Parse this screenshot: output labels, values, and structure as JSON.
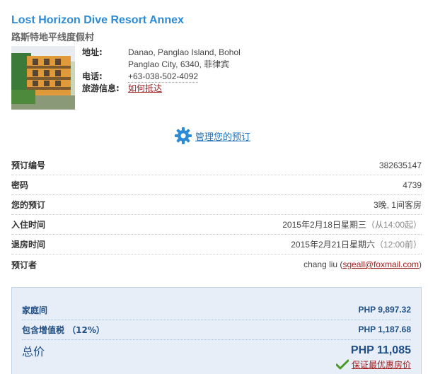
{
  "hotel": {
    "name": "Lost Horizon Dive Resort Annex",
    "name_cn": "路斯特地平线度假村",
    "address_label": "地址:",
    "address_line1": "Danao, Panglao Island, Bohol",
    "address_line2": "Panglao City, 6340, 菲律宾",
    "phone_label": "电话:",
    "phone": "+63-038-502-4092",
    "travel_label": "旅游信息:",
    "travel_link": "如何抵达"
  },
  "manage": {
    "label": "管理您的预订",
    "icon": "gear-icon"
  },
  "details": {
    "booking_no_label": "预订编号",
    "booking_no": "382635147",
    "pin_label": "密码",
    "pin": "4739",
    "reservation_label": "您的预订",
    "reservation": "3晚, 1间客房",
    "checkin_label": "入住时间",
    "checkin_date": "2015年2月18日星期三",
    "checkin_time": "（从14:00起）",
    "checkout_label": "退房时间",
    "checkout_date": "2015年2月21日星期六",
    "checkout_time": "（12:00前）",
    "booker_label": "预订者",
    "booker_name": "chang liu (",
    "booker_email": "sgeall@foxmail.com",
    "booker_close": ")"
  },
  "price": {
    "room_label": "家庭间",
    "room_price": "PHP 9,897.32",
    "vat_label": "包含增值税 （12%）",
    "vat_price": "PHP 1,187.68",
    "total_label": "总价",
    "total_price": "PHP 11,085",
    "guarantee": "保证最优惠房价"
  },
  "colors": {
    "accent": "#2d8bd6",
    "link_red": "#a21d1d",
    "price_blue": "#1f4f86",
    "price_bg": "#e7eef7"
  }
}
